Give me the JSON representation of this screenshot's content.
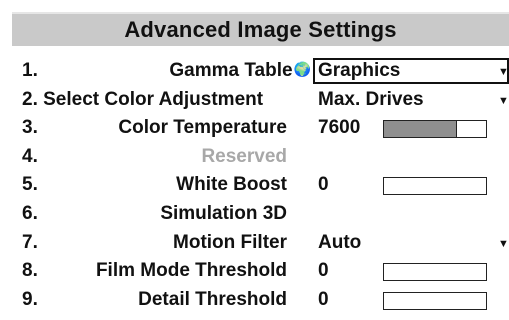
{
  "title": "Advanced Image Settings",
  "rows": [
    {
      "num": "1.",
      "label": "Gamma Table",
      "globe": "🌍",
      "value": "Graphics",
      "dropdown": true
    },
    {
      "num": "",
      "label": "2. Select Color Adjustment",
      "value": "Max. Drives",
      "dropdown": true
    },
    {
      "num": "3.",
      "label": "Color Temperature",
      "value": "7600",
      "slider_fraction": 0.72
    },
    {
      "num": "4.",
      "label": "Reserved",
      "value": ""
    },
    {
      "num": "5.",
      "label": "White Boost",
      "value": "0",
      "slider_fraction": 0
    },
    {
      "num": "6.",
      "label": "Simulation 3D",
      "value": ""
    },
    {
      "num": "7.",
      "label": "Motion Filter",
      "value": "Auto",
      "dropdown": true
    },
    {
      "num": "8.",
      "label": "Film Mode Threshold",
      "value": "0",
      "slider_fraction": 0
    },
    {
      "num": "9.",
      "label": "Detail Threshold",
      "value": "0",
      "slider_fraction": 0
    }
  ],
  "dropdown_arrow": "▼",
  "colors": {
    "title_bg": "#c9c9c9",
    "disabled_text": "#a8a8a8",
    "slider_fill": "#8f8f8f"
  }
}
